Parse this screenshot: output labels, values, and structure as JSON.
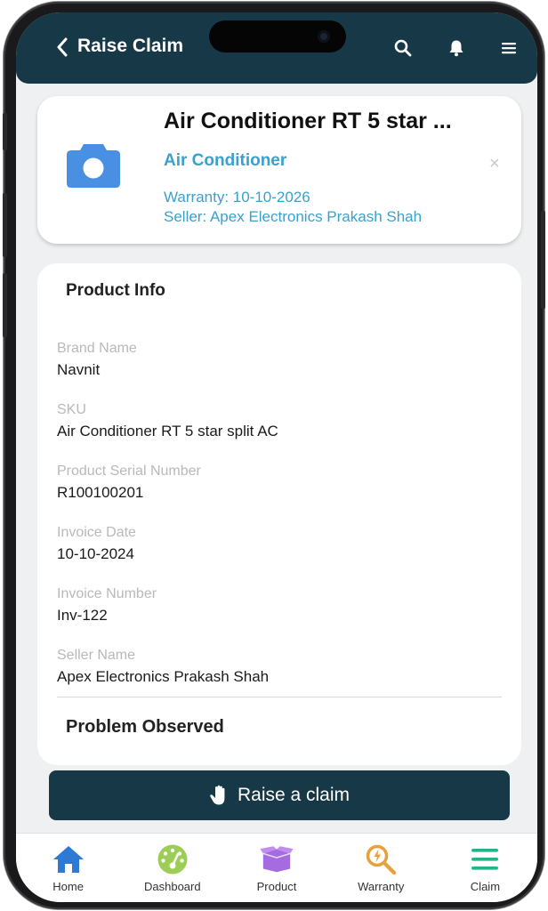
{
  "header": {
    "title": "Raise Claim"
  },
  "product_card": {
    "title": "Air Conditioner RT 5 star ...",
    "category": "Air Conditioner",
    "warranty": "Warranty: 10-10-2026",
    "seller": "Seller: Apex Electronics Prakash Shah",
    "close_symbol": "×"
  },
  "product_info": {
    "heading": "Product Info",
    "fields": [
      {
        "label": "Brand Name",
        "value": "Navnit"
      },
      {
        "label": "SKU",
        "value": "Air Conditioner RT 5 star split AC"
      },
      {
        "label": "Product Serial Number",
        "value": "R100100201"
      },
      {
        "label": "Invoice Date",
        "value": "10-10-2024"
      },
      {
        "label": "Invoice Number",
        "value": "Inv-122"
      },
      {
        "label": "Seller Name",
        "value": "Apex Electronics Prakash Shah"
      }
    ],
    "problem_heading": "Problem Observed"
  },
  "action": {
    "raise_label": "Raise a claim"
  },
  "bottom_nav": {
    "items": [
      {
        "label": "Home",
        "icon": "home-icon",
        "color": "#2e79d6"
      },
      {
        "label": "Dashboard",
        "icon": "gauge-icon",
        "color": "#9ccd55"
      },
      {
        "label": "Product",
        "icon": "box-icon",
        "color": "#a56be0"
      },
      {
        "label": "Warranty",
        "icon": "warranty-search-icon",
        "color": "#e8a13a"
      },
      {
        "label": "Claim",
        "icon": "menu-icon",
        "color": "#26b38a"
      }
    ]
  },
  "colors": {
    "header_bg": "#173846",
    "accent_blue": "#3aa1cc",
    "camera_blue": "#4a90e2"
  }
}
